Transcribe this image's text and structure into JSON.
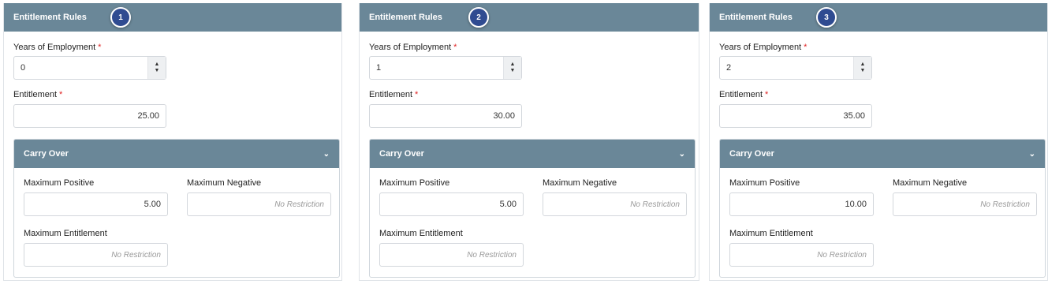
{
  "panels": [
    {
      "header": "Entitlement Rules",
      "badge": "1",
      "years_label": "Years of Employment",
      "years_value": "0",
      "entitlement_label": "Entitlement",
      "entitlement_value": "25.00",
      "carry_title": "Carry Over",
      "max_pos_label": "Maximum Positive",
      "max_pos_value": "5.00",
      "max_neg_label": "Maximum Negative",
      "max_neg_placeholder": "No Restriction",
      "max_ent_label": "Maximum Entitlement",
      "max_ent_placeholder": "No Restriction"
    },
    {
      "header": "Entitlement Rules",
      "badge": "2",
      "years_label": "Years of Employment",
      "years_value": "1",
      "entitlement_label": "Entitlement",
      "entitlement_value": "30.00",
      "carry_title": "Carry Over",
      "max_pos_label": "Maximum Positive",
      "max_pos_value": "5.00",
      "max_neg_label": "Maximum Negative",
      "max_neg_placeholder": "No Restriction",
      "max_ent_label": "Maximum Entitlement",
      "max_ent_placeholder": "No Restriction"
    },
    {
      "header": "Entitlement Rules",
      "badge": "3",
      "years_label": "Years of Employment",
      "years_value": "2",
      "entitlement_label": "Entitlement",
      "entitlement_value": "35.00",
      "carry_title": "Carry Over",
      "max_pos_label": "Maximum Positive",
      "max_pos_value": "10.00",
      "max_neg_label": "Maximum Negative",
      "max_neg_placeholder": "No Restriction",
      "max_ent_label": "Maximum Entitlement",
      "max_ent_placeholder": "No Restriction"
    }
  ],
  "colors": {
    "header_bg": "#6a8798",
    "badge_bg": "#2f4b91",
    "required": "#e02424"
  },
  "icons": {
    "spinner": "up-down-arrows-icon",
    "collapse": "chevron-down-icon"
  }
}
